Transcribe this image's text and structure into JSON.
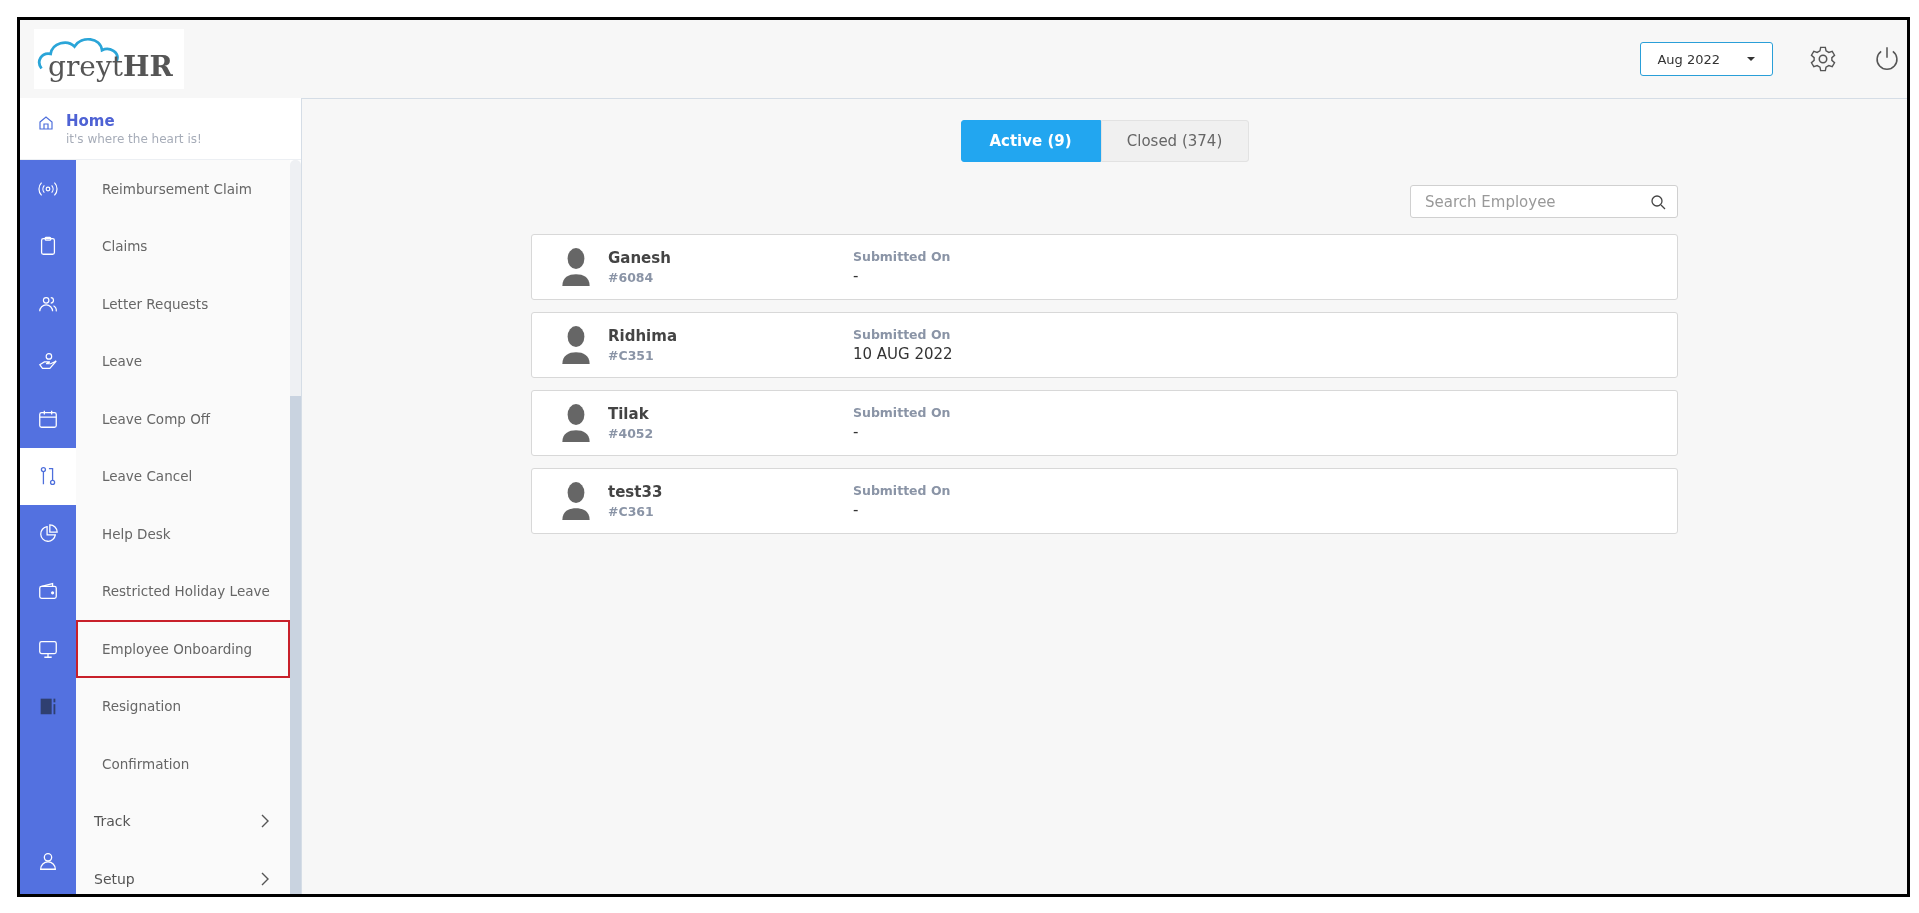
{
  "logo": {
    "text": "greyt**HR**"
  },
  "header": {
    "month": "Aug 2022"
  },
  "home": {
    "title": "Home",
    "subtitle": "it's where the heart is!"
  },
  "rail": [
    {
      "selected": false
    },
    {
      "selected": false
    },
    {
      "selected": false
    },
    {
      "selected": false
    },
    {
      "selected": false
    },
    {
      "selected": true
    },
    {
      "selected": false
    },
    {
      "selected": false
    },
    {
      "selected": false
    },
    {
      "selected": false
    }
  ],
  "menu": [
    {
      "kind": "link",
      "label": "Reimbursement Claim",
      "highlighted": false
    },
    {
      "kind": "link",
      "label": "Claims",
      "highlighted": false
    },
    {
      "kind": "link",
      "label": "Letter Requests",
      "highlighted": false
    },
    {
      "kind": "link",
      "label": "Leave",
      "highlighted": false
    },
    {
      "kind": "link",
      "label": "Leave Comp Off",
      "highlighted": false
    },
    {
      "kind": "link",
      "label": "Leave Cancel",
      "highlighted": false
    },
    {
      "kind": "link",
      "label": "Help Desk",
      "highlighted": false
    },
    {
      "kind": "link",
      "label": "Restricted Holiday Leave",
      "highlighted": false
    },
    {
      "kind": "link",
      "label": "Employee Onboarding",
      "highlighted": true
    },
    {
      "kind": "link",
      "label": "Resignation",
      "highlighted": false
    },
    {
      "kind": "link",
      "label": "Confirmation",
      "highlighted": false
    },
    {
      "kind": "group",
      "label": "Track",
      "highlighted": false
    },
    {
      "kind": "group",
      "label": "Setup",
      "highlighted": false
    }
  ],
  "tabs": [
    {
      "label": "Active (9)",
      "selected": true
    },
    {
      "label": "Closed (374)",
      "selected": false
    }
  ],
  "search": {
    "placeholder": "Search Employee"
  },
  "employees": [
    {
      "name": "Ganesh",
      "id": "#6084",
      "submitted_label": "Submitted On",
      "submitted_on": "-"
    },
    {
      "name": "Ridhima",
      "id": "#C351",
      "submitted_label": "Submitted On",
      "submitted_on": "10 AUG 2022"
    },
    {
      "name": "Tilak",
      "id": "#4052",
      "submitted_label": "Submitted On",
      "submitted_on": "-"
    },
    {
      "name": "test33",
      "id": "#C361",
      "submitted_label": "Submitted On",
      "submitted_on": "-"
    }
  ]
}
